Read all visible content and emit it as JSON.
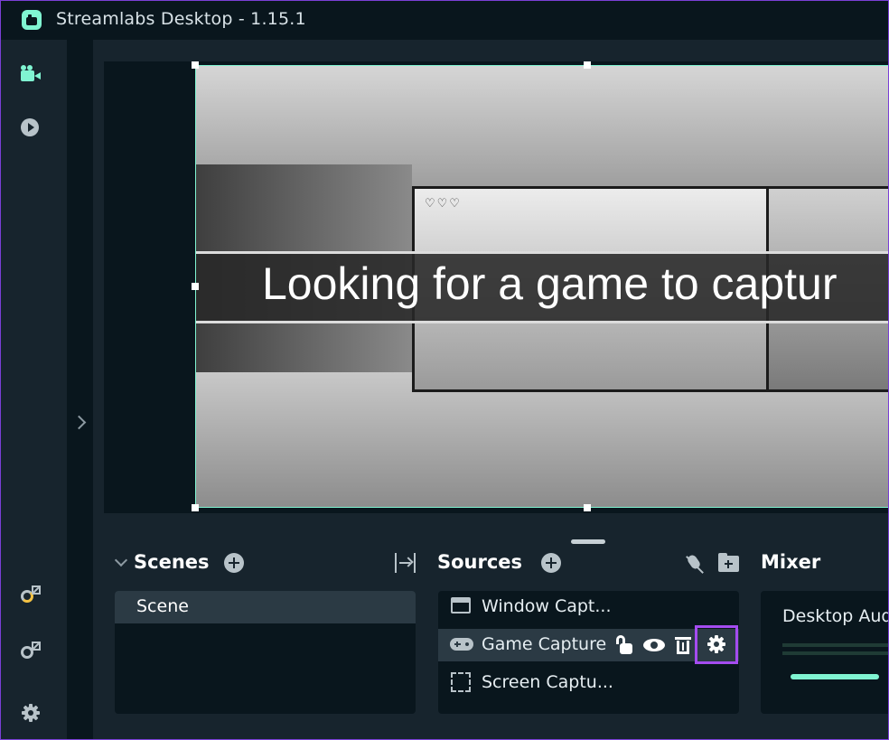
{
  "window": {
    "title": "Streamlabs Desktop - 1.15.1"
  },
  "nav": {
    "icons": [
      "camera-icon",
      "play-icon",
      "external-link-icon",
      "external-help-icon",
      "gear-icon"
    ]
  },
  "preview": {
    "overlay_text": "Looking for a game to captur"
  },
  "scenes": {
    "title": "Scenes",
    "items": [
      "Scene"
    ]
  },
  "sources": {
    "title": "Sources",
    "items": [
      {
        "label": "Window Capt...",
        "icon": "window-icon"
      },
      {
        "label": "Game Capture",
        "icon": "gamepad-icon",
        "selected": true
      },
      {
        "label": "Screen Captu...",
        "icon": "screen-icon"
      }
    ]
  },
  "mixer": {
    "title": "Mixer",
    "items": [
      {
        "label": "Desktop Aud",
        "level": 0.9
      }
    ]
  },
  "colors": {
    "accent": "#80f5d2",
    "highlight": "#a44cf0",
    "background": "#09161d",
    "panel": "#17242d"
  }
}
